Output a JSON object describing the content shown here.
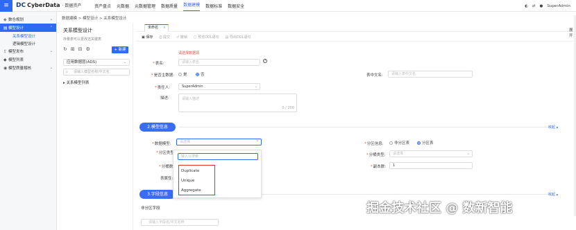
{
  "header": {
    "brand": "CyberData",
    "brand_sub": "· 数据资产",
    "nav": [
      "资产盘点",
      "元数据",
      "元数据管理",
      "数据质量",
      "数据建模",
      "数据标准",
      "数据安全"
    ],
    "user": "SuperAdmin"
  },
  "sidebar": {
    "items": [
      {
        "label": "数仓规划"
      },
      {
        "label": "模型设计"
      },
      {
        "label": "模型发布"
      },
      {
        "label": "模型列表"
      },
      {
        "label": "模型质量稽核"
      }
    ],
    "subitems": [
      "关系模型设计",
      "逻辑模型设计"
    ]
  },
  "breadcrumb": "数据建模 > 模型设计 > 关系模型设计",
  "tree": {
    "title": "关系模型设计",
    "subtitle": "存量表可以更改还关键表",
    "new_button": "+ 新建",
    "layer": "应用数据层(ADS)",
    "search_placeholder": "请输入模型名称/中文名",
    "root": "关系模型列表"
  },
  "tab": {
    "label": "未命名"
  },
  "toolbar": [
    "保存",
    "提交",
    "撤销",
    "预览DDL语句",
    "导出DDL语句"
  ],
  "form": {
    "warning": "请选择数据源",
    "table_name_label": "表名:",
    "table_name_placeholder": "请输入表名",
    "main_data_label": "是否主数据:",
    "yes": "是",
    "no": "否",
    "cn_name_label": "表中文名:",
    "cn_name_placeholder": "请输入表中文名",
    "owner_label": "责任人:",
    "owner_value": "SuperAdmin",
    "desc_label": "描述:",
    "desc_placeholder": "请输入描述",
    "desc_count": "0 / 200"
  },
  "section2": {
    "title": "2.模型信息",
    "collapse": "收起 ▴",
    "model_type_label": "数据模型:",
    "model_type_placeholder": "请选择",
    "part_type_label": "分区类型:",
    "bucket_label": "分桶数:",
    "table_attr_label": "表属性:",
    "partition_label": "分区信息:",
    "non_partition": "非分区表",
    "partition_table": "分区表",
    "bucket_type_label": "分桶类型:",
    "bucket_type_placeholder": "请选择",
    "replica_label": "副本数:",
    "replica_value": "1"
  },
  "dropdown": {
    "search_placeholder": "输入以搜索",
    "options": [
      "Duplicate",
      "Unique",
      "Aggregate"
    ]
  },
  "section3": {
    "title": "3.字段信息",
    "collapse": "收起 ▴",
    "partition_fields": "非分区字段",
    "field_search_placeholder": "请输入字段名/中文名称"
  },
  "right_side": [
    "展",
    "开"
  ],
  "watermark_brand": "掘金技术社区 @ 数新智能",
  "colors": {
    "accent": "#2f6bf2",
    "warning": "#e04b3a"
  }
}
